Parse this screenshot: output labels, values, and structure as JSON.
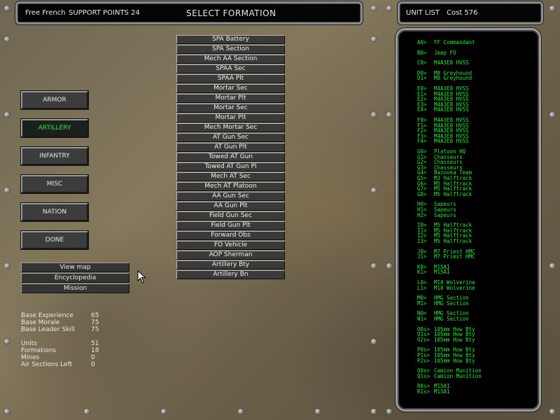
{
  "header": {
    "nation": "Free French",
    "support_label": "SUPPORT POINTS 24",
    "title": "SELECT FORMATION",
    "unit_list_label": "UNIT LIST",
    "cost_label": "Cost 576"
  },
  "categories": [
    {
      "label": "ARMOR",
      "selected": false
    },
    {
      "label": "ARTILLERY",
      "selected": true
    },
    {
      "label": "INFANTRY",
      "selected": false
    },
    {
      "label": "MISC",
      "selected": false
    },
    {
      "label": "NATION",
      "selected": false
    },
    {
      "label": "DONE",
      "selected": false
    }
  ],
  "utility_buttons": [
    "View map",
    "Encyclopedia",
    "Mission"
  ],
  "formations": [
    "SPA Battery",
    "SPA Section",
    "Mech AA Section",
    "SPAA Sec",
    "SPAA Plt",
    "Mortar Sec",
    "Mortar Plt",
    "Mortar Sec",
    "Mortar Plt",
    "Mech Mortar Sec",
    "AT Gun Sec",
    "AT Gun Plt",
    "Towed AT Gun",
    "Towed AT Gun Pl",
    "Mech AT Sec",
    "Mech AT Platoon",
    "AA Gun Sec",
    "AA Gun Plt",
    "Field Gun Sec",
    "Field Gun Plt",
    "Forward Obs",
    "FO Vehicle",
    "AOP Sherman",
    "Artillery Bty",
    "Artillery Bn"
  ],
  "stats_base": [
    {
      "label": "Base Experience",
      "value": "65"
    },
    {
      "label": "Base Morale",
      "value": "75"
    },
    {
      "label": "Base Leader Skill",
      "value": "75"
    }
  ],
  "stats_counts": [
    {
      "label": "Units",
      "value": "51"
    },
    {
      "label": "Formations",
      "value": "18"
    },
    {
      "label": "Mines",
      "value": "0"
    },
    {
      "label": "Air Sections Left",
      "value": "0"
    }
  ],
  "units": [
    {
      "code": "A0>",
      "name": "FF Commandant"
    },
    {
      "code": "B0>",
      "name": "Jeep FO"
    },
    {
      "code": "C0>",
      "name": "M4A3E8 HVSS"
    },
    {
      "code": "D0>",
      "name": "M8 Greyhound"
    },
    {
      "code": "D1>",
      "name": "M8 Greyhound"
    },
    {
      "code": "E0>",
      "name": "M4A3E8 HVSS"
    },
    {
      "code": "E1>",
      "name": "M4A3E8 HVSS"
    },
    {
      "code": "E2>",
      "name": "M4A3E8 HVSS"
    },
    {
      "code": "E3>",
      "name": "M4A3E8 HVSS"
    },
    {
      "code": "E4>",
      "name": "M4A3E8 HVSS"
    },
    {
      "code": "F0>",
      "name": "M4A3E8 HVSS"
    },
    {
      "code": "F1>",
      "name": "M4A3E8 HVSS"
    },
    {
      "code": "F2>",
      "name": "M4A3E8 HVSS"
    },
    {
      "code": "F3>",
      "name": "M4A3E8 HVSS"
    },
    {
      "code": "F4>",
      "name": "M4A3E8 HVSS"
    },
    {
      "code": "G0>",
      "name": "Platoon HQ"
    },
    {
      "code": "G1>",
      "name": "Chasseurs"
    },
    {
      "code": "G2>",
      "name": "Chasseurs"
    },
    {
      "code": "G3>",
      "name": "Chasseurs"
    },
    {
      "code": "G4>",
      "name": "Bazooka Team"
    },
    {
      "code": "G5>",
      "name": "M3 Halftrack"
    },
    {
      "code": "G6>",
      "name": "M5 Halftrack"
    },
    {
      "code": "G7>",
      "name": "M5 Halftrack"
    },
    {
      "code": "G8>",
      "name": "M5 Halftrack"
    },
    {
      "code": "H0>",
      "name": "Sapeurs"
    },
    {
      "code": "H1>",
      "name": "Sapeurs"
    },
    {
      "code": "H2>",
      "name": "Sapeurs"
    },
    {
      "code": "I0>",
      "name": "M5 Halftrack"
    },
    {
      "code": "I1>",
      "name": "M5 Halftrack"
    },
    {
      "code": "I2>",
      "name": "M5 Halftrack"
    },
    {
      "code": "I3>",
      "name": "M5 Halftrack"
    },
    {
      "code": "J0>",
      "name": "M7 Priest HMC"
    },
    {
      "code": "J1>",
      "name": "M7 Priest HMC"
    },
    {
      "code": "K0>",
      "name": "M15A1"
    },
    {
      "code": "K1>",
      "name": "M15A1"
    },
    {
      "code": "L0>",
      "name": "M10 Wolverine"
    },
    {
      "code": "L1>",
      "name": "M10 Wolverine"
    },
    {
      "code": "M0>",
      "name": "HMG Section"
    },
    {
      "code": "M1>",
      "name": "HMG Section"
    },
    {
      "code": "N0>",
      "name": "HMG Section"
    },
    {
      "code": "N1>",
      "name": "HMG Section"
    },
    {
      "code": "O0s>",
      "name": "105mm How Bty"
    },
    {
      "code": "O1s>",
      "name": "105mm How Bty"
    },
    {
      "code": "O2s>",
      "name": "105mm How Bty"
    },
    {
      "code": "P0s>",
      "name": "105mm How Bty"
    },
    {
      "code": "P1s>",
      "name": "105mm How Bty"
    },
    {
      "code": "P2s>",
      "name": "105mm How Bty"
    },
    {
      "code": "Q0s>",
      "name": "Camion Munition"
    },
    {
      "code": "Q1s>",
      "name": "Camion Munition"
    },
    {
      "code": "R0s>",
      "name": "M15A1"
    },
    {
      "code": "R1s>",
      "name": "M15A1"
    }
  ]
}
